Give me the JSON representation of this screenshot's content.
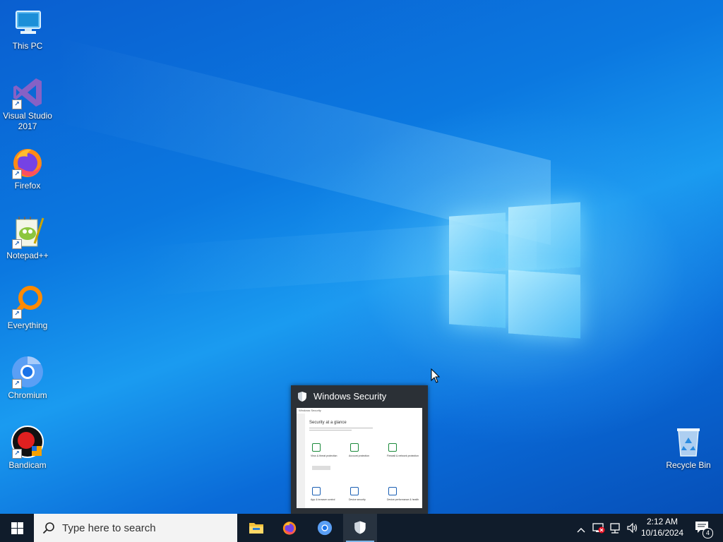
{
  "desktop": {
    "icons": [
      {
        "label": "This PC",
        "icon": "this-pc-icon",
        "shortcut": false
      },
      {
        "label": "Visual Studio 2017",
        "icon": "visual-studio-icon",
        "shortcut": true
      },
      {
        "label": "Firefox",
        "icon": "firefox-icon",
        "shortcut": true
      },
      {
        "label": "Notepad++",
        "icon": "notepadpp-icon",
        "shortcut": true
      },
      {
        "label": "Everything",
        "icon": "everything-icon",
        "shortcut": true
      },
      {
        "label": "Chromium",
        "icon": "chromium-icon",
        "shortcut": true
      },
      {
        "label": "Bandicam",
        "icon": "bandicam-icon",
        "shortcut": true
      }
    ],
    "recycle_bin": {
      "label": "Recycle Bin",
      "icon": "recycle-bin-icon"
    }
  },
  "preview": {
    "title": "Windows Security",
    "icon": "shield-icon",
    "thumbnail": {
      "window_title": "Windows Security",
      "heading": "Security at a glance",
      "tiles": [
        {
          "label": "Virus & threat protection",
          "color": "#1a8a3a"
        },
        {
          "label": "Account protection",
          "color": "#1a8a3a"
        },
        {
          "label": "Firewall & network protection",
          "color": "#1a8a3a"
        },
        {
          "label": "App & browser control",
          "color": "#1a5fb4"
        },
        {
          "label": "Device security",
          "color": "#1a5fb4"
        },
        {
          "label": "Device performance & health",
          "color": "#1a5fb4"
        }
      ]
    }
  },
  "taskbar": {
    "search_placeholder": "Type here to search",
    "apps": [
      {
        "name": "File Explorer",
        "icon": "file-explorer-icon",
        "active": false
      },
      {
        "name": "Firefox",
        "icon": "firefox-icon",
        "active": false
      },
      {
        "name": "Chromium",
        "icon": "chromium-icon",
        "active": false
      },
      {
        "name": "Windows Security",
        "icon": "shield-icon",
        "active": true
      }
    ],
    "tray": {
      "icons": [
        "chevron-up-icon",
        "security-alert-icon",
        "network-icon",
        "volume-icon"
      ],
      "time": "2:12 AM",
      "date": "10/16/2024",
      "notification_count": "4"
    }
  },
  "colors": {
    "taskbar_bg": "#101c2b",
    "accent": "#7fb7ea",
    "desktop_blue": "#0b78e0"
  }
}
